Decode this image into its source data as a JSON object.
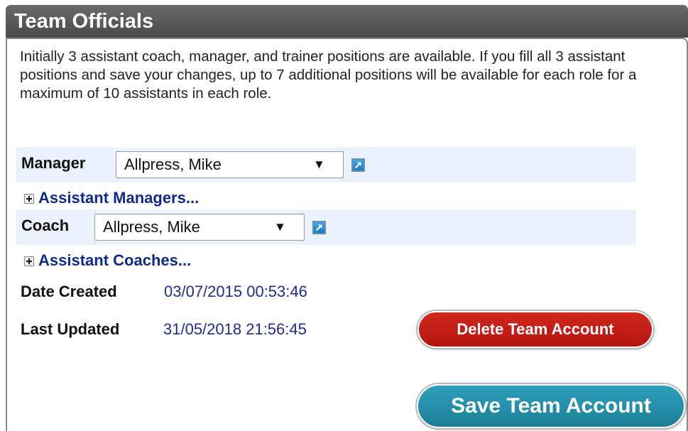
{
  "panel": {
    "title": "Team Officials",
    "intro_text": "Initially 3 assistant coach, manager, and trainer positions are available. If you fill all 3 assistant positions and save your changes, up to 7 additional positions will be available for each role for a maximum of 10 assistants in each role."
  },
  "manager": {
    "label": "Manager",
    "selected_value": "Allpress, Mike",
    "assistants_label": "Assistant Managers..."
  },
  "coach": {
    "label": "Coach",
    "selected_value": "Allpress, Mike",
    "assistants_label": "Assistant Coaches..."
  },
  "meta": {
    "date_created_label": "Date Created",
    "date_created_value": "03/07/2015 00:53:46",
    "last_updated_label": "Last Updated",
    "last_updated_value": "31/05/2018 21:56:45"
  },
  "actions": {
    "delete_label": "Delete Team Account",
    "save_label": "Save Team Account"
  },
  "colors": {
    "header_bg": "#555555",
    "row_band": "#eaf3fb",
    "link": "#0e2a8a",
    "value_text": "#1e2d8e",
    "delete_button": "#c41e16",
    "save_button": "#2590ab"
  },
  "icons": {
    "popup": "external-popup-icon",
    "dropdown": "dropdown-arrow-icon",
    "expand": "expand-plus-icon"
  }
}
